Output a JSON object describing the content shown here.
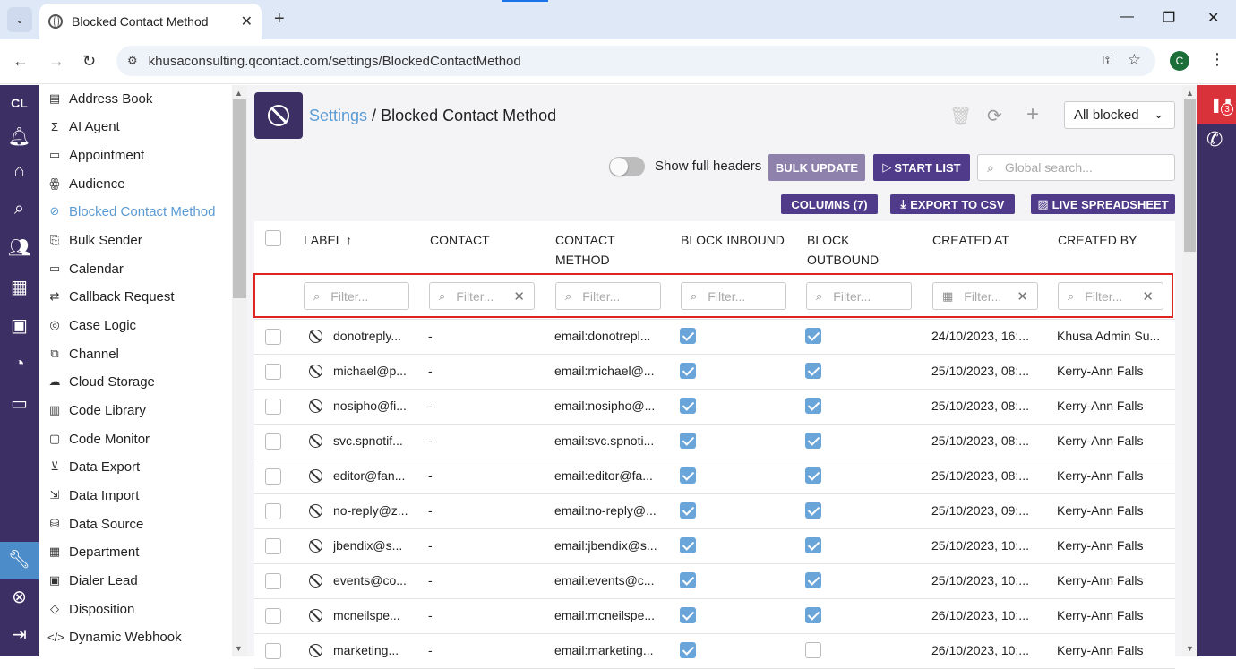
{
  "browser": {
    "tab_title": "Blocked Contact Method",
    "url": "khusaconsulting.qcontact.com/settings/BlockedContactMethod",
    "profile_initial": "C"
  },
  "rail": {
    "initials": "CL",
    "icons": [
      "bell-icon",
      "home-icon",
      "search-icon",
      "users-icon",
      "building-icon",
      "briefcase-icon",
      "pie-chart-icon",
      "monitor-icon",
      "wrench-icon",
      "life-ring-icon",
      "sign-out-icon"
    ]
  },
  "sidebar": {
    "items": [
      {
        "label": "Address Book",
        "icon": "address-book-icon"
      },
      {
        "label": "AI Agent",
        "icon": "sigma-icon"
      },
      {
        "label": "Appointment",
        "icon": "calendar-icon"
      },
      {
        "label": "Audience",
        "icon": "audience-icon"
      },
      {
        "label": "Blocked Contact Method",
        "icon": "ban-icon",
        "active": true
      },
      {
        "label": "Bulk Sender",
        "icon": "bulk-sender-icon"
      },
      {
        "label": "Calendar",
        "icon": "calendar-icon"
      },
      {
        "label": "Callback Request",
        "icon": "callback-icon"
      },
      {
        "label": "Case Logic",
        "icon": "case-logic-icon"
      },
      {
        "label": "Channel",
        "icon": "channel-icon"
      },
      {
        "label": "Cloud Storage",
        "icon": "cloud-icon"
      },
      {
        "label": "Code Library",
        "icon": "code-library-icon"
      },
      {
        "label": "Code Monitor",
        "icon": "code-monitor-icon"
      },
      {
        "label": "Data Export",
        "icon": "download-icon"
      },
      {
        "label": "Data Import",
        "icon": "file-import-icon"
      },
      {
        "label": "Data Source",
        "icon": "database-icon"
      },
      {
        "label": "Department",
        "icon": "department-icon"
      },
      {
        "label": "Dialer Lead",
        "icon": "dialer-lead-icon"
      },
      {
        "label": "Disposition",
        "icon": "tag-icon"
      },
      {
        "label": "Dynamic Webhook",
        "icon": "code-icon"
      }
    ]
  },
  "header": {
    "breadcrumb_link": "Settings",
    "breadcrumb_sep": " / ",
    "breadcrumb_current": "Blocked Contact Method",
    "view_select": "All blocked"
  },
  "toolbar": {
    "toggle_label": "Show full headers",
    "bulk_update": "BULK UPDATE",
    "start_list": "START LIST",
    "search_placeholder": "Global search...",
    "columns": "COLUMNS (7)",
    "export_csv": "EXPORT TO CSV",
    "live_spreadsheet": "LIVE SPREADSHEET"
  },
  "table": {
    "headers": {
      "label": "LABEL",
      "contact": "CONTACT",
      "contact_method_1": "CONTACT",
      "contact_method_2": "METHOD",
      "block_inbound": "BLOCK INBOUND",
      "block_outbound_1": "BLOCK",
      "block_outbound_2": "OUTBOUND",
      "created_at": "CREATED AT",
      "created_by": "CREATED BY"
    },
    "filter_placeholder": "Filter...",
    "rows": [
      {
        "label": "donotreply...",
        "contact": "-",
        "method": "email:donotrepl...",
        "inbound": true,
        "outbound": true,
        "created_at": "24/10/2023, 16:...",
        "created_by": "Khusa Admin Su..."
      },
      {
        "label": "michael@p...",
        "contact": "-",
        "method": "email:michael@...",
        "inbound": true,
        "outbound": true,
        "created_at": "25/10/2023, 08:...",
        "created_by": "Kerry-Ann Falls"
      },
      {
        "label": "nosipho@fi...",
        "contact": "-",
        "method": "email:nosipho@...",
        "inbound": true,
        "outbound": true,
        "created_at": "25/10/2023, 08:...",
        "created_by": "Kerry-Ann Falls"
      },
      {
        "label": "svc.spnotif...",
        "contact": "-",
        "method": "email:svc.spnoti...",
        "inbound": true,
        "outbound": true,
        "created_at": "25/10/2023, 08:...",
        "created_by": "Kerry-Ann Falls"
      },
      {
        "label": "editor@fan...",
        "contact": "-",
        "method": "email:editor@fa...",
        "inbound": true,
        "outbound": true,
        "created_at": "25/10/2023, 08:...",
        "created_by": "Kerry-Ann Falls"
      },
      {
        "label": "no-reply@z...",
        "contact": "-",
        "method": "email:no-reply@...",
        "inbound": true,
        "outbound": true,
        "created_at": "25/10/2023, 09:...",
        "created_by": "Kerry-Ann Falls"
      },
      {
        "label": "jbendix@s...",
        "contact": "-",
        "method": "email:jbendix@s...",
        "inbound": true,
        "outbound": true,
        "created_at": "25/10/2023, 10:...",
        "created_by": "Kerry-Ann Falls"
      },
      {
        "label": "events@co...",
        "contact": "-",
        "method": "email:events@c...",
        "inbound": true,
        "outbound": true,
        "created_at": "25/10/2023, 10:...",
        "created_by": "Kerry-Ann Falls"
      },
      {
        "label": "mcneilspe...",
        "contact": "-",
        "method": "email:mcneilspe...",
        "inbound": true,
        "outbound": true,
        "created_at": "26/10/2023, 10:...",
        "created_by": "Kerry-Ann Falls"
      },
      {
        "label": "marketing...",
        "contact": "-",
        "method": "email:marketing...",
        "inbound": true,
        "outbound": false,
        "created_at": "26/10/2023, 10:...",
        "created_by": "Kerry-Ann Falls"
      }
    ]
  },
  "right_rail": {
    "badge_count": "3"
  },
  "colors": {
    "brand_purple": "#3b2f63",
    "accent_blue": "#5a9bd4",
    "checkbox_blue": "#6aa5d9",
    "highlight_red": "#e02424"
  }
}
